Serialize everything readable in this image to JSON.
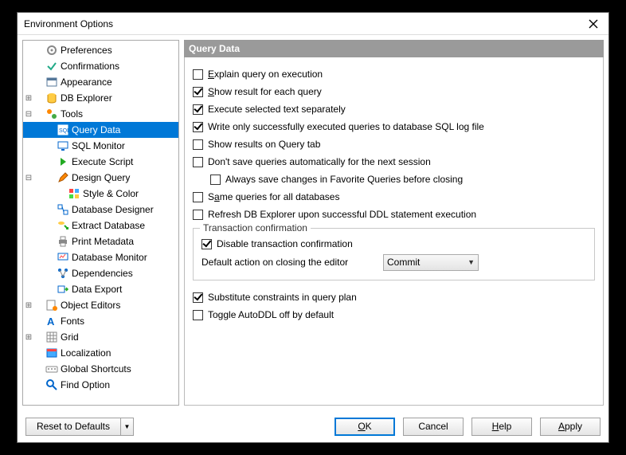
{
  "window": {
    "title": "Environment Options"
  },
  "tree": {
    "preferences": "Preferences",
    "confirmations": "Confirmations",
    "appearance": "Appearance",
    "dbexplorer": "DB Explorer",
    "tools": "Tools",
    "query_data": "Query Data",
    "sql_monitor": "SQL Monitor",
    "execute_script": "Execute Script",
    "design_query": "Design Query",
    "style_color": "Style & Color",
    "database_designer": "Database Designer",
    "extract_database": "Extract Database",
    "print_metadata": "Print Metadata",
    "database_monitor": "Database Monitor",
    "dependencies": "Dependencies",
    "data_export": "Data Export",
    "object_editors": "Object Editors",
    "fonts": "Fonts",
    "grid": "Grid",
    "localization": "Localization",
    "global_shortcuts": "Global Shortcuts",
    "find_option": "Find Option"
  },
  "panel": {
    "title": "Query Data"
  },
  "opts": {
    "explain": "Explain query on execution",
    "show_result": "Show result for each query",
    "exec_selected": "Execute selected text separately",
    "write_log": "Write only successfully executed queries to database SQL log file",
    "show_tab": "Show results on Query tab",
    "dont_save": "Don't save queries automatically for the next session",
    "always_save_fav": "Always save changes in Favorite Queries before closing",
    "same_queries": "Same queries for all databases",
    "refresh_db": "Refresh DB Explorer upon successful DDL statement execution",
    "disable_tx": "Disable transaction confirmation",
    "default_action_lbl": "Default action on closing the editor",
    "default_action_val": "Commit",
    "tx_legend": "Transaction confirmation",
    "substitute": "Substitute constraints in query plan",
    "toggle_ddl": "Toggle AutoDDL off by default"
  },
  "buttons": {
    "reset": "Reset to Defaults",
    "ok": "OK",
    "cancel": "Cancel",
    "help": "Help",
    "apply": "Apply"
  }
}
